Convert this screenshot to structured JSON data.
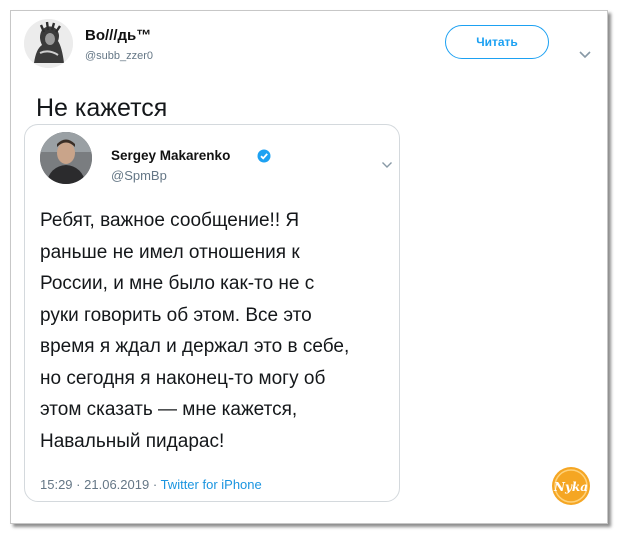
{
  "tweet": {
    "display_name": "Во///дь™",
    "handle": "@subb_zzer0",
    "follow_label": "Читать",
    "text": "Не кажется"
  },
  "quoted": {
    "display_name": "Sergey Makarenko",
    "handle": "@SpmBp",
    "lines": [
      "Ребят, важное сообщение!! Я",
      "раньше не имел отношения к",
      "России, и мне было как-то не с",
      "руки говорить об этом. Все это",
      "время я ждал и держал это в себе,",
      "но сегодня я наконец-то могу об",
      "этом сказать — мне кажется,",
      "Навальный пидарас!"
    ],
    "time": "15:29",
    "date": "21.06.2019",
    "separator": "·",
    "source": "Twitter for iPhone"
  },
  "watermark": {
    "text": "Nyka"
  },
  "icons": [
    "avatar-image",
    "chevron-down-icon",
    "verified-badge-icon",
    "watermark-logo"
  ],
  "colors": {
    "accent": "#1da1f2",
    "muted": "#657786",
    "border": "#d4d9dd",
    "watermark": "#f5a623"
  }
}
